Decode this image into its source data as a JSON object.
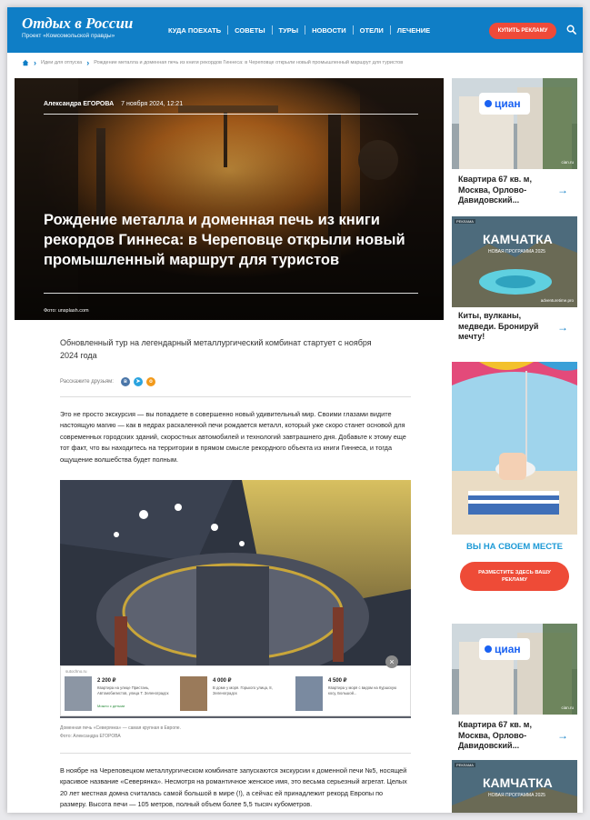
{
  "header": {
    "logo_title": "Отдых в России",
    "logo_subtitle": "Проект «Комсомольской правды»",
    "nav": [
      "КУДА ПОЕХАТЬ",
      "СОВЕТЫ",
      "ТУРЫ",
      "НОВОСТИ",
      "ОТЕЛИ",
      "ЛЕЧЕНИЕ"
    ],
    "ad_button": "КУПИТЬ РЕКЛАМУ",
    "search_icon": "search-icon",
    "brand_color": "#0f7ec6",
    "accent_color": "#ef4a39"
  },
  "breadcrumb": {
    "items": [
      "Идеи для отпуска",
      "Рождение металла и доменная печь из книги рекордов Гиннеса: в Череповце открыли новый промышленный маршрут для туристов"
    ]
  },
  "article": {
    "author": "Александра ЕГОРОВА",
    "date": "7 ноября 2024, 12:21",
    "title": "Рождение металла и доменная печь из книги рекордов Гиннеса: в Череповце открыли новый промышленный маршрут для туристов",
    "photo_credit": "Фото: unsplash.com",
    "lead": "Обновленный тур на легендарный металлургический комбинат стартует с ноября 2024 года",
    "share_label": "Расскажите друзьям:",
    "share_icons": [
      "vk-icon",
      "telegram-icon",
      "ok-icon"
    ],
    "paragraph1": "Это не просто экскурсия — вы попадаете в совершенно новый удивительный мир. Своими глазами видите настоящую магию — как в недрах раскаленной печи рождается металл, который уже скоро станет основой для современных городских зданий, скоростных автомобилей и технологий завтрашнего дня. Добавьте к этому еще тот факт, что вы находитесь на территории в прямом смысле рекордного объекта из книги Гиннеса, и тогда ощущение волшебства будет полным.",
    "image_caption": "Доменная печь «Северянка» — самая крупная в Европе.",
    "image_credit": "Фото: Александра ЕГОРОВА",
    "paragraph2": "В ноябре на Череповецком металлургическом комбинате запускаются экскурсии к доменной печи №5, носящей красивое название «Северянка». Несмотря на романтичное женское имя, это весьма серьезный агрегат. Целых 20 лет местная домна считалась самой большой в мире (!), а сейчас ей принадлежит рекорд Европы по размеру. Высота печи — 105 метров, полный объем более 5,5 тысяч кубометров."
  },
  "inline_ad": {
    "source": "sutochno.ru",
    "close": "×",
    "cards": [
      {
        "price": "2 200 ₽",
        "desc": "Квартира на улице Пристань, Автомобилистов, улица Т. Зеленоградск",
        "tag": "Можно с детьми"
      },
      {
        "price": "4 000 ₽",
        "desc": "В доме у моря. Горького улица, 8, Зеленоградск",
        "tag": ""
      },
      {
        "price": "4 500 ₽",
        "desc": "Квартира у моря с видом на Куршскую косу, Большой...",
        "tag": ""
      }
    ]
  },
  "sidebar": {
    "ad1": {
      "brand": "циан",
      "title": "Квартира 67 кв. м, Москва, Орлово-Давидовский...",
      "domain": "cian.ru"
    },
    "ad2": {
      "label": "РЕКЛАМА",
      "brand": "КАМЧАТКА",
      "subtitle": "НОВАЯ ПРОГРАММА 2025",
      "title": "Киты, вулканы, медведи. Бронируй мечту!",
      "domain": "adventuretime.pro"
    },
    "big": {
      "slogan": "ВЫ НА СВОЕМ МЕСТЕ",
      "button": "РАЗМЕСТИТЕ ЗДЕСЬ ВАШУ РЕКЛАМУ"
    },
    "ad3": {
      "brand": "циан",
      "title": "Квартира 67 кв. м, Москва, Орлово-Давидовский...",
      "domain": "cian.ru"
    },
    "ad4": {
      "label": "РЕКЛАМА",
      "brand": "КАМЧАТКА",
      "subtitle": "НОВАЯ ПРОГРАММА 2025"
    },
    "arrow": "→"
  }
}
